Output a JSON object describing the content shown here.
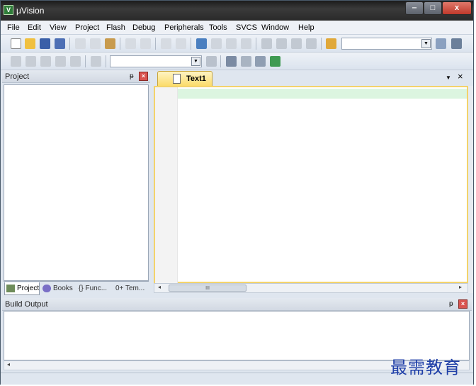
{
  "window": {
    "title": "μVision"
  },
  "titlebar_buttons": {
    "minimize": "‒",
    "maximize": "□",
    "close": "x"
  },
  "menu": [
    "File",
    "Edit",
    "View",
    "Project",
    "Flash",
    "Debug",
    "Peripherals",
    "Tools",
    "SVCS",
    "Window",
    "Help"
  ],
  "project_panel": {
    "title": "Project",
    "pin": "ᵽ",
    "tabs": [
      {
        "label": "Project",
        "active": true
      },
      {
        "label": "Books",
        "active": false
      },
      {
        "label": "{} Func...",
        "active": false
      },
      {
        "label": "0+ Tem...",
        "active": false
      }
    ]
  },
  "editor": {
    "tab_label": "Text1",
    "tab_menu": "▼",
    "tab_close": "×",
    "scroll_thumb": "III",
    "scroll_left": "◂",
    "scroll_right": "▸"
  },
  "build_output": {
    "title": "Build Output",
    "pin": "ᵽ"
  },
  "watermark": "最需教育",
  "colors": {
    "accent_tab": "#fbdc6b",
    "current_line": "#dcf5e0",
    "close_red": "#c0392b"
  }
}
